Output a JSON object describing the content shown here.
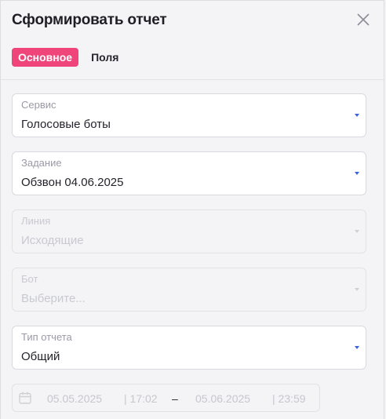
{
  "dialog": {
    "title": "Сформировать отчет",
    "close_icon": "close-icon",
    "tabs": [
      {
        "label": "Основное",
        "active": true
      },
      {
        "label": "Поля",
        "active": false
      }
    ]
  },
  "fields": [
    {
      "label": "Сервис",
      "value": "Голосовые боты",
      "disabled": false
    },
    {
      "label": "Задание",
      "value": "Обзвон 04.06.2025",
      "disabled": false
    },
    {
      "label": "Линия",
      "value": "Исходящие",
      "disabled": true
    },
    {
      "label": "Бот",
      "value": "Выберите...",
      "disabled": true
    },
    {
      "label": "Тип отчета",
      "value": "Общий",
      "disabled": false
    }
  ],
  "date_range": {
    "icon": "calendar-icon",
    "from_date": "05.05.2025",
    "from_time": "| 17:02",
    "separator": "–",
    "to_date": "05.06.2025",
    "to_time": "| 23:59"
  },
  "colors": {
    "accent": "#f0457a",
    "caret": "#3b63e0"
  }
}
